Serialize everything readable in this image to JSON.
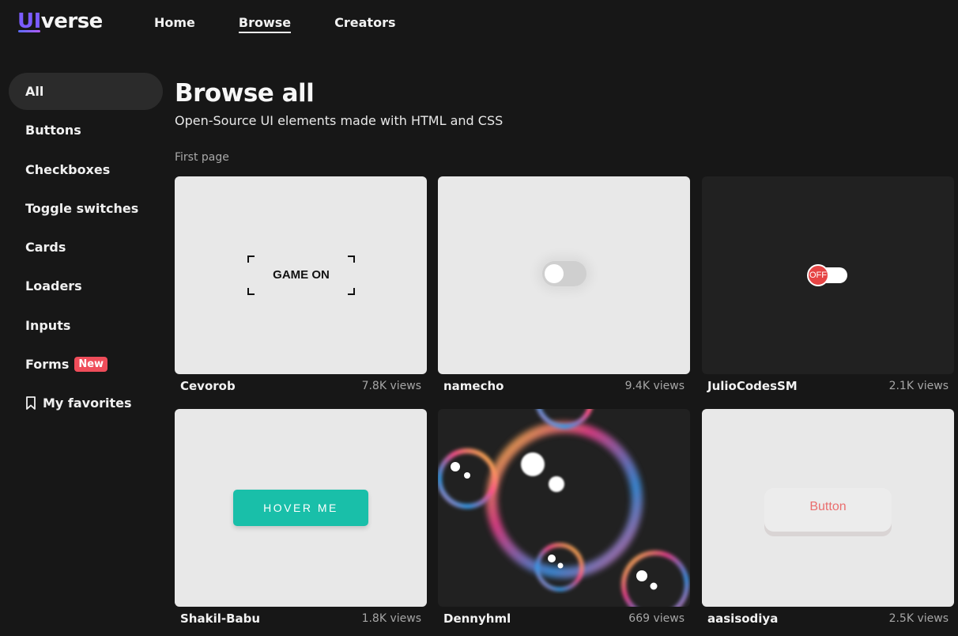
{
  "header": {
    "logo_ui": "UI",
    "logo_verse": "verse",
    "nav": [
      "Home",
      "Browse",
      "Creators"
    ]
  },
  "sidebar": {
    "items": [
      "All",
      "Buttons",
      "Checkboxes",
      "Toggle switches",
      "Cards",
      "Loaders",
      "Inputs",
      "Forms",
      "My favorites"
    ],
    "new_badge": "New"
  },
  "main": {
    "title": "Browse all",
    "subtitle": "Open-Source UI elements made with HTML and CSS",
    "page_label": "First page"
  },
  "cards": [
    {
      "author": "Cevorob",
      "views": "7.8K views",
      "preview_text": "GAME ON"
    },
    {
      "author": "namecho",
      "views": "9.4K views"
    },
    {
      "author": "JulioCodesSM",
      "views": "2.1K views",
      "preview_text": "OFF"
    },
    {
      "author": "Shakil-Babu",
      "views": "1.8K views",
      "preview_text": "HOVER ME"
    },
    {
      "author": "Dennyhml",
      "views": "669 views"
    },
    {
      "author": "aasisodiya",
      "views": "2.5K views",
      "preview_text": "Button"
    }
  ],
  "colors": {
    "background": "#171717",
    "accent": "#7b5cff",
    "teal_button": "#19bfa9",
    "badge_red": "#ef4d5a"
  }
}
